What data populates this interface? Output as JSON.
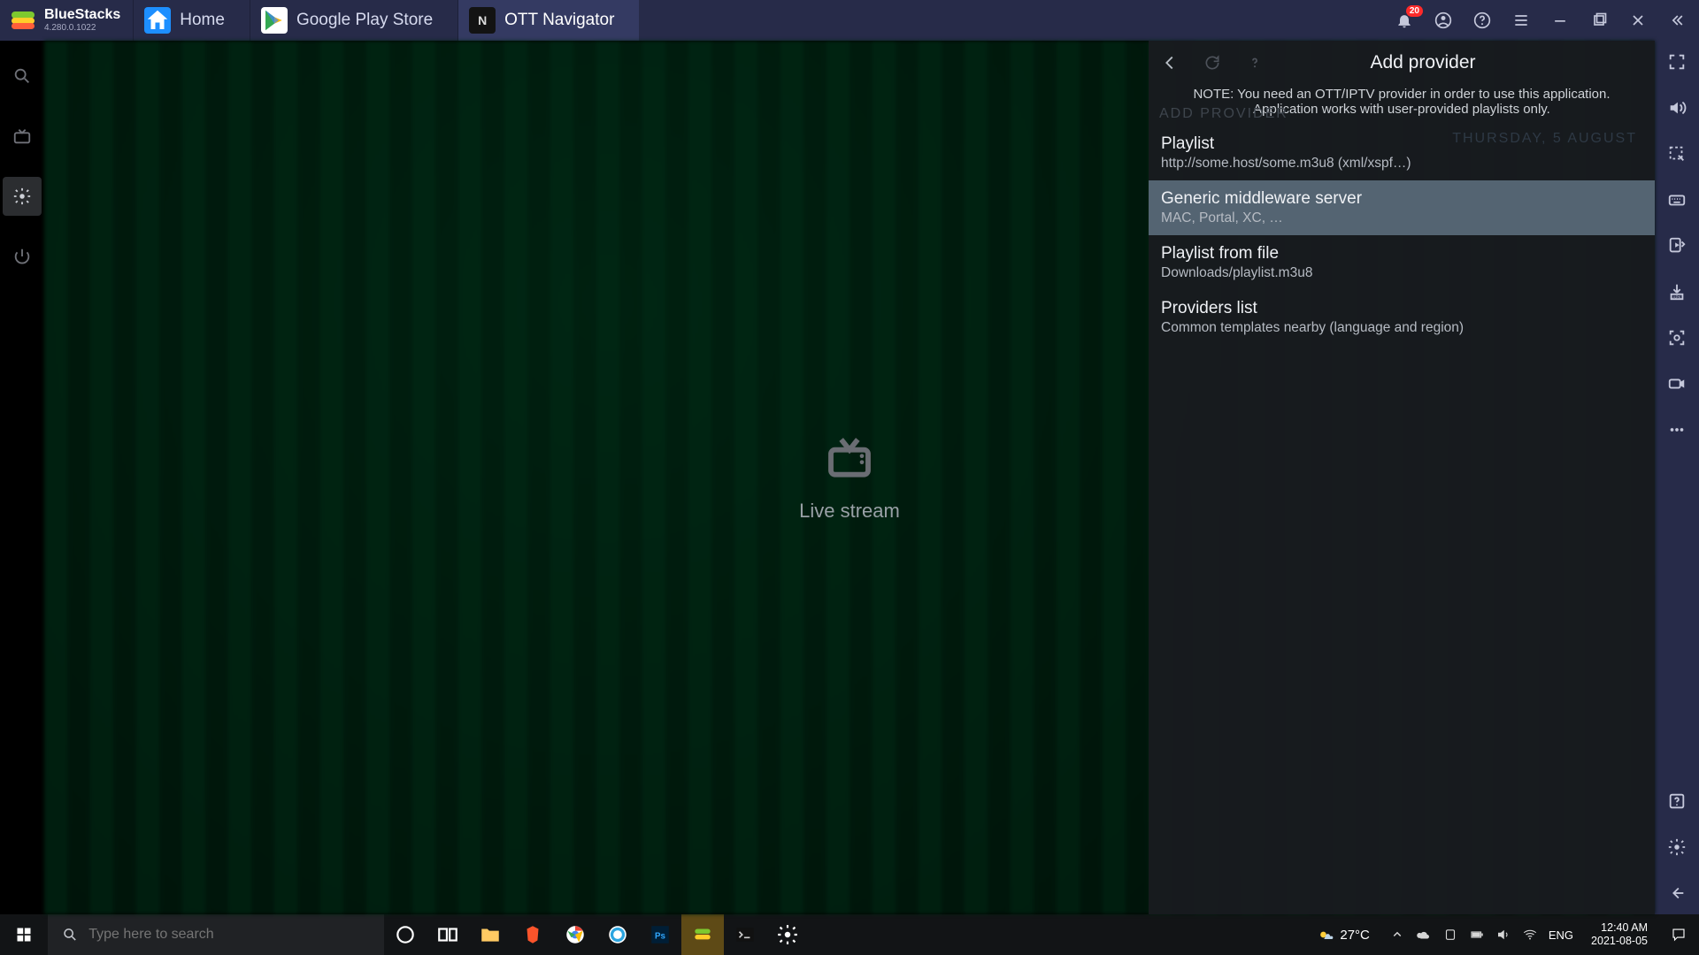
{
  "bluestacks": {
    "brand": "BlueStacks",
    "version": "4.280.0.1022",
    "notification_count": "20",
    "tabs": [
      {
        "label": "Home",
        "icon": "home"
      },
      {
        "label": "Google Play Store",
        "icon": "play"
      },
      {
        "label": "OTT Navigator",
        "icon": "ott",
        "active": true
      }
    ],
    "right_toolbar": [
      "fullscreen",
      "volume",
      "select-tool",
      "keyboard",
      "media-sync",
      "apk-install",
      "camera-scan",
      "record",
      "more",
      "help-box",
      "settings",
      "back-arrow"
    ]
  },
  "live_stream_label": "Live stream",
  "hidden_bg_1": "ADD PROVIDER",
  "hidden_bg_2": "THURSDAY, 5 AUGUST",
  "panel": {
    "title": "Add provider",
    "note": "NOTE: You need an OTT/IPTV provider in order to use this application. Application works with user-provided playlists only.",
    "options": [
      {
        "title": "Playlist",
        "sub": "http://some.host/some.m3u8 (xml/xspf…)",
        "selected": false
      },
      {
        "title": "Generic middleware server",
        "sub": "MAC, Portal, XC, …",
        "selected": true
      },
      {
        "title": "Playlist from file",
        "sub": "Downloads/playlist.m3u8",
        "selected": false
      },
      {
        "title": "Providers list",
        "sub": "Common templates nearby (language and region)",
        "selected": false
      }
    ]
  },
  "taskbar": {
    "search_placeholder": "Type here to search",
    "weather_temp": "27°C",
    "lang": "ENG",
    "time": "12:40 AM",
    "date": "2021-08-05"
  }
}
